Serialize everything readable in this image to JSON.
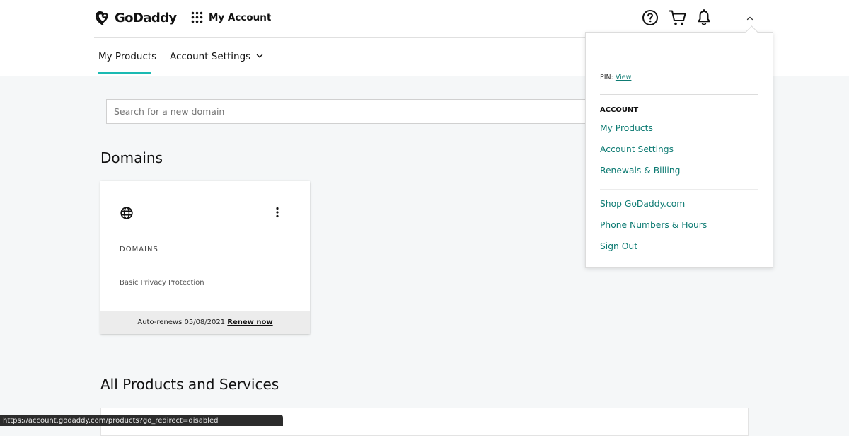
{
  "header": {
    "logo_text": "GoDaddy",
    "app_title": "My Account",
    "icons": [
      "help-icon",
      "cart-icon",
      "bell-icon",
      "chevron-up-icon"
    ]
  },
  "tabs": [
    {
      "label": "My Products",
      "active": true
    },
    {
      "label": "Account Settings",
      "has_dropdown": true
    }
  ],
  "search": {
    "placeholder": "Search for a new domain",
    "value": ""
  },
  "domains_section": {
    "heading": "Domains",
    "card": {
      "icon": "globe-icon",
      "title": "DOMAINS",
      "subtitle": "Basic Privacy Protection",
      "footer_text": "Auto-renews 05/08/2021",
      "footer_link": "Renew now"
    }
  },
  "products_section": {
    "heading": "All Products and Services"
  },
  "dropdown": {
    "pin_label": "PIN:",
    "pin_link": "View",
    "account_heading": "ACCOUNT",
    "account_links": [
      "My Products",
      "Account Settings",
      "Renewals & Billing"
    ],
    "other_links": [
      "Shop GoDaddy.com",
      "Phone Numbers & Hours",
      "Sign Out"
    ]
  },
  "status_bar": {
    "url": "https://account.godaddy.com/products?go_redirect=disabled"
  },
  "colors": {
    "accent": "#1bbab3",
    "link": "#0e7b73",
    "background": "#f5f7f8"
  }
}
